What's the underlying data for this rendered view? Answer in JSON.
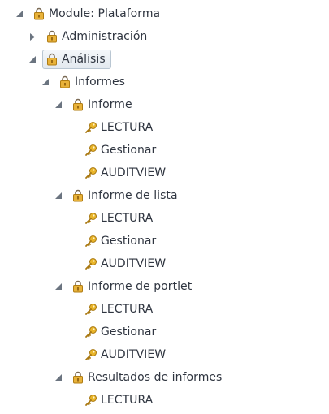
{
  "tree": {
    "root": {
      "label": "Module: Plataforma",
      "icon": "lock-icon",
      "expanded": true
    },
    "administracion": {
      "label": "Administración",
      "icon": "lock-icon",
      "expanded": false
    },
    "analisis": {
      "label": "Análisis",
      "icon": "lock-icon",
      "expanded": true,
      "selected": true
    },
    "informes": {
      "label": "Informes",
      "icon": "lock-icon",
      "expanded": true
    },
    "informe": {
      "label": "Informe",
      "icon": "lock-icon",
      "expanded": true,
      "permissions": [
        "LECTURA",
        "Gestionar",
        "AUDITVIEW"
      ]
    },
    "informe_lista": {
      "label": "Informe de lista",
      "icon": "lock-icon",
      "expanded": true,
      "permissions": [
        "LECTURA",
        "Gestionar",
        "AUDITVIEW"
      ]
    },
    "informe_portlet": {
      "label": "Informe de portlet",
      "icon": "lock-icon",
      "expanded": true,
      "permissions": [
        "LECTURA",
        "Gestionar",
        "AUDITVIEW"
      ]
    },
    "resultados": {
      "label": "Resultados de informes",
      "icon": "lock-icon",
      "expanded": true,
      "permissions": [
        "LECTURA"
      ]
    },
    "permission_icon": "key-icon"
  },
  "colors": {
    "text": "#2f3540",
    "toggle": "#6b7480",
    "lock_body": "#e8b23a",
    "lock_shackle": "#7a6a55",
    "key": "#d9a520",
    "selected_border": "#b9c6d2"
  }
}
